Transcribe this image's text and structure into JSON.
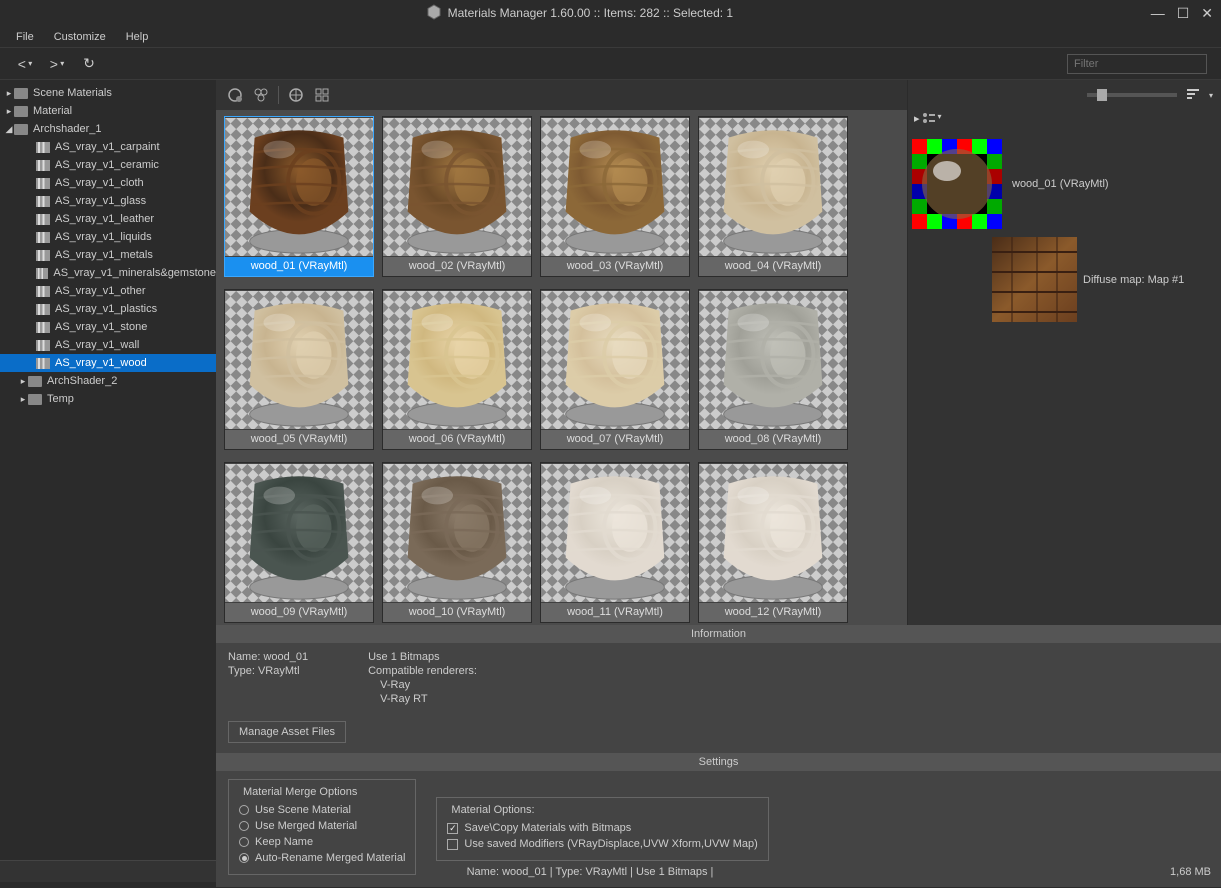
{
  "title": "Materials Manager 1.60.00  :: Items: 282  :: Selected: 1",
  "menu": {
    "file": "File",
    "customize": "Customize",
    "help": "Help"
  },
  "filter": {
    "placeholder": "Filter"
  },
  "tree": {
    "scene": "Scene Materials",
    "material": "Material",
    "arch1": "Archshader_1",
    "items": [
      "AS_vray_v1_carpaint",
      "AS_vray_v1_ceramic",
      "AS_vray_v1_cloth",
      "AS_vray_v1_glass",
      "AS_vray_v1_leather",
      "AS_vray_v1_liquids",
      "AS_vray_v1_metals",
      "AS_vray_v1_minerals&gemstone",
      "AS_vray_v1_other",
      "AS_vray_v1_plastics",
      "AS_vray_v1_stone",
      "AS_vray_v1_wall",
      "AS_vray_v1_wood"
    ],
    "arch2": "ArchShader_2",
    "temp": "Temp"
  },
  "thumbs": [
    "wood_01 (VRayMtl)",
    "wood_02 (VRayMtl)",
    "wood_03 (VRayMtl)",
    "wood_04 (VRayMtl)",
    "wood_05 (VRayMtl)",
    "wood_06 (VRayMtl)",
    "wood_07 (VRayMtl)",
    "wood_08 (VRayMtl)",
    "wood_09 (VRayMtl)",
    "wood_10 (VRayMtl)",
    "wood_11 (VRayMtl)",
    "wood_12 (VRayMtl)"
  ],
  "preview": {
    "name": "wood_01 (VRayMtl)",
    "diffuse": "Diffuse map: Map #1"
  },
  "sections": {
    "info": "Information",
    "settings": "Settings"
  },
  "info": {
    "name": "Name: wood_01",
    "type": "Type: VRayMtl",
    "bm": "Use 1 Bitmaps",
    "cr": "Compatible renderers:",
    "r1": "V-Ray",
    "r2": "V-Ray RT",
    "btn": "Manage Asset Files"
  },
  "settings": {
    "merge_title": "Material  Merge Options",
    "opt1": "Use Scene Material",
    "opt2": "Use Merged Material",
    "opt3": "Keep Name",
    "opt4": "Auto-Rename Merged Material",
    "mat_title": "Material Options:",
    "chk1": "Save\\Copy Materials with Bitmaps",
    "chk2": "Use saved Modifiers (VRayDisplace,UVW Xform,UVW Map)"
  },
  "status": {
    "center": "Name: wood_01 | Type: VRayMtl | Use 1 Bitmaps  |",
    "right": "1,68 MB"
  },
  "colors": {
    "w1": [
      "#4a2d18",
      "#8b5a2b",
      "#6b3f1f"
    ],
    "w2": [
      "#6b4a28",
      "#a07640",
      "#7a5530"
    ],
    "w3": [
      "#7e5a32",
      "#b28a50",
      "#8c6838"
    ],
    "w4": [
      "#c8b490",
      "#e0d0b0",
      "#d0c0a0"
    ],
    "w5": [
      "#c8b490",
      "#e0d0b0",
      "#d0c0a0"
    ],
    "w6": [
      "#d0b880",
      "#e8d4a8",
      "#d8c490"
    ],
    "w7": [
      "#d4c09c",
      "#e8dcc0",
      "#dccca8"
    ],
    "w8": [
      "#a0a098",
      "#c0c0b8",
      "#b0b0a8"
    ],
    "w9": [
      "#3a4540",
      "#5a6560",
      "#4a5550"
    ],
    "w10": [
      "#6a5a48",
      "#8a7a68",
      "#7a6a58"
    ],
    "w11": [
      "#d8d0c4",
      "#ece6dc",
      "#e2dad0"
    ],
    "w12": [
      "#d8d0c4",
      "#ece6dc",
      "#e2dad0"
    ]
  }
}
